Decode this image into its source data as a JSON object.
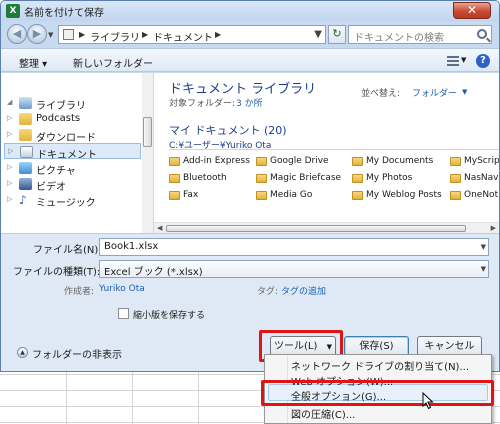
{
  "window": {
    "title": "名前を付けて保存",
    "app_icon": "X",
    "close": "✕"
  },
  "nav": {
    "back": "◀",
    "forward": "▶",
    "breadcrumb": [
      "ライブラリ",
      "ドキュメント"
    ],
    "search_placeholder": "ドキュメントの検索"
  },
  "commands": {
    "organize": "整理 ▾",
    "new_folder": "新しいフォルダー"
  },
  "sidebar": {
    "items": [
      {
        "label": "ライブラリ",
        "expander": "◢",
        "icon": "library-icon"
      },
      {
        "label": "Podcasts",
        "expander": "▷",
        "icon": "folder-icon"
      },
      {
        "label": "ダウンロード",
        "expander": "▷",
        "icon": "folder-icon"
      },
      {
        "label": "ドキュメント",
        "expander": "▷",
        "icon": "documents-icon"
      },
      {
        "label": "ピクチャ",
        "expander": "▷",
        "icon": "pictures-icon"
      },
      {
        "label": "ビデオ",
        "expander": "▷",
        "icon": "video-icon"
      },
      {
        "label": "ミュージック",
        "expander": "▷",
        "icon": "music-icon"
      }
    ]
  },
  "content": {
    "library_title": "ドキュメント ライブラリ",
    "target_label": "対象フォルダー:",
    "target_value": "3 か所",
    "sort_label": "並べ替え:",
    "sort_value": "フォルダー",
    "section_title": "マイ ドキュメント (20)",
    "section_path": "C:¥ユーザー¥Yuriko Ota",
    "folders": [
      [
        "Add-in Express",
        "Google Drive",
        "My Documents",
        "MyScrip"
      ],
      [
        "Bluetooth",
        "Magic Briefcase",
        "My Photos",
        "NasNav"
      ],
      [
        "Fax",
        "Media Go",
        "My Weblog Posts",
        "OneNot"
      ]
    ]
  },
  "form": {
    "filename_label": "ファイル名(N):",
    "filename_value": "Book1.xlsx",
    "filetype_label": "ファイルの種類(T):",
    "filetype_value": "Excel ブック (*.xlsx)",
    "author_label": "作成者:",
    "author_value": "Yuriko Ota",
    "tags_label": "タグ:",
    "tags_value": "タグの追加",
    "thumbnail_label": "縮小版を保存する"
  },
  "footer": {
    "hide_folders": "フォルダーの非表示",
    "tools": "ツール(L)",
    "tools_arrow": "▼",
    "save": "保存(S)",
    "cancel": "キャンセル"
  },
  "tools_menu": {
    "items": [
      "ネットワーク ドライブの割り当て(N)...",
      "Web オプション(W)...",
      "全般オプション(G)...",
      "図の圧縮(C)..."
    ],
    "highlighted_index": 2
  },
  "colors": {
    "highlight_frame": "#e01414",
    "link": "#1a5fb4",
    "title_blue": "#1e3f88"
  }
}
